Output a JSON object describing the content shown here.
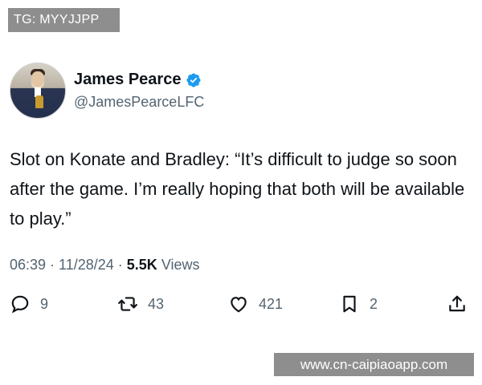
{
  "banner": {
    "text": "TG: MYYJJPP"
  },
  "author": {
    "display_name": "James Pearce",
    "handle": "@JamesPearceLFC",
    "verified_color": "#1d9bf0"
  },
  "tweet": {
    "text": "Slot on Konate and Bradley: “It’s difficult to judge so soon after the game. I’m really hoping that both will be available to play.”",
    "time": "06:39",
    "date": "11/28/24",
    "views_count": "5.5K",
    "views_label": "Views",
    "separator": "·"
  },
  "actions": {
    "reply_count": "9",
    "retweet_count": "43",
    "like_count": "421",
    "bookmark_count": "2"
  },
  "watermark": {
    "text": "www.cn-caipiaoapp.com"
  },
  "colors": {
    "text_primary": "#0f1419",
    "text_secondary": "#536471",
    "overlay_gray": "#8e8e8e"
  }
}
